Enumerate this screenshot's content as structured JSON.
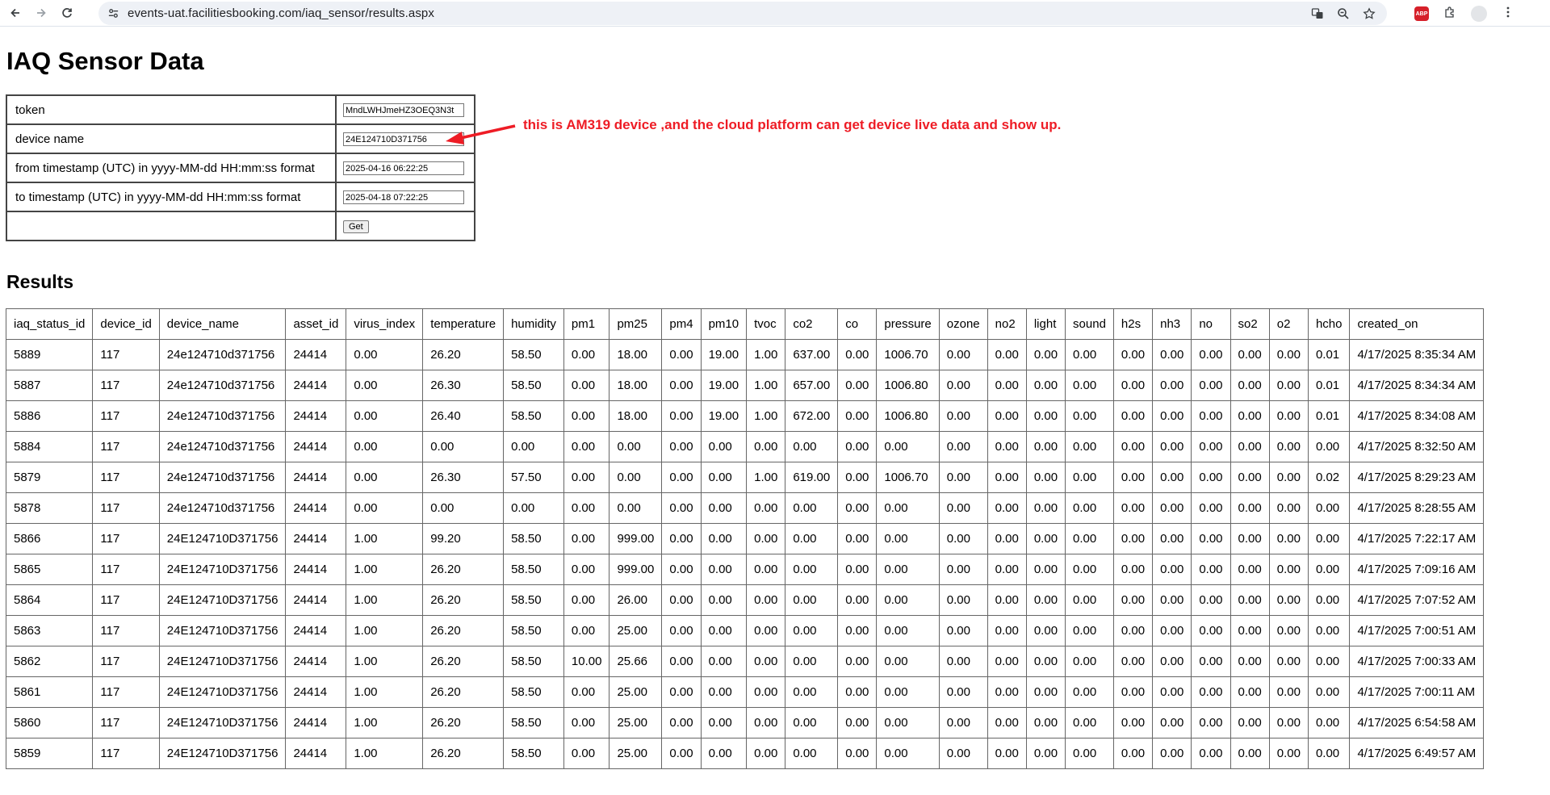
{
  "browser": {
    "url": "events-uat.facilitiesbooking.com/iaq_sensor/results.aspx"
  },
  "page": {
    "title": "IAQ Sensor Data",
    "results_heading": "Results"
  },
  "form": {
    "token_label": "token",
    "token_value": "MndLWHJmeHZ3OEQ3N3t",
    "device_label": "device name",
    "device_value": "24E124710D371756",
    "from_label": "from timestamp (UTC) in yyyy-MM-dd HH:mm:ss format",
    "from_value": "2025-04-16 06:22:25",
    "to_label": "to timestamp (UTC) in yyyy-MM-dd HH:mm:ss format",
    "to_value": "2025-04-18 07:22:25",
    "get_label": "Get"
  },
  "annotation": {
    "text": "this is AM319 device ,and the cloud platform can get device live data and show up.",
    "color": "#ee1c25"
  },
  "table": {
    "columns": [
      "iaq_status_id",
      "device_id",
      "device_name",
      "asset_id",
      "virus_index",
      "temperature",
      "humidity",
      "pm1",
      "pm25",
      "pm4",
      "pm10",
      "tvoc",
      "co2",
      "co",
      "pressure",
      "ozone",
      "no2",
      "light",
      "sound",
      "h2s",
      "nh3",
      "no",
      "so2",
      "o2",
      "hcho",
      "created_on"
    ],
    "rows": [
      [
        "5889",
        "117",
        "24e124710d371756",
        "24414",
        "0.00",
        "26.20",
        "58.50",
        "0.00",
        "18.00",
        "0.00",
        "19.00",
        "1.00",
        "637.00",
        "0.00",
        "1006.70",
        "0.00",
        "0.00",
        "0.00",
        "0.00",
        "0.00",
        "0.00",
        "0.00",
        "0.00",
        "0.00",
        "0.01",
        "4/17/2025 8:35:34 AM"
      ],
      [
        "5887",
        "117",
        "24e124710d371756",
        "24414",
        "0.00",
        "26.30",
        "58.50",
        "0.00",
        "18.00",
        "0.00",
        "19.00",
        "1.00",
        "657.00",
        "0.00",
        "1006.80",
        "0.00",
        "0.00",
        "0.00",
        "0.00",
        "0.00",
        "0.00",
        "0.00",
        "0.00",
        "0.00",
        "0.01",
        "4/17/2025 8:34:34 AM"
      ],
      [
        "5886",
        "117",
        "24e124710d371756",
        "24414",
        "0.00",
        "26.40",
        "58.50",
        "0.00",
        "18.00",
        "0.00",
        "19.00",
        "1.00",
        "672.00",
        "0.00",
        "1006.80",
        "0.00",
        "0.00",
        "0.00",
        "0.00",
        "0.00",
        "0.00",
        "0.00",
        "0.00",
        "0.00",
        "0.01",
        "4/17/2025 8:34:08 AM"
      ],
      [
        "5884",
        "117",
        "24e124710d371756",
        "24414",
        "0.00",
        "0.00",
        "0.00",
        "0.00",
        "0.00",
        "0.00",
        "0.00",
        "0.00",
        "0.00",
        "0.00",
        "0.00",
        "0.00",
        "0.00",
        "0.00",
        "0.00",
        "0.00",
        "0.00",
        "0.00",
        "0.00",
        "0.00",
        "0.00",
        "4/17/2025 8:32:50 AM"
      ],
      [
        "5879",
        "117",
        "24e124710d371756",
        "24414",
        "0.00",
        "26.30",
        "57.50",
        "0.00",
        "0.00",
        "0.00",
        "0.00",
        "1.00",
        "619.00",
        "0.00",
        "1006.70",
        "0.00",
        "0.00",
        "0.00",
        "0.00",
        "0.00",
        "0.00",
        "0.00",
        "0.00",
        "0.00",
        "0.02",
        "4/17/2025 8:29:23 AM"
      ],
      [
        "5878",
        "117",
        "24e124710d371756",
        "24414",
        "0.00",
        "0.00",
        "0.00",
        "0.00",
        "0.00",
        "0.00",
        "0.00",
        "0.00",
        "0.00",
        "0.00",
        "0.00",
        "0.00",
        "0.00",
        "0.00",
        "0.00",
        "0.00",
        "0.00",
        "0.00",
        "0.00",
        "0.00",
        "0.00",
        "4/17/2025 8:28:55 AM"
      ],
      [
        "5866",
        "117",
        "24E124710D371756",
        "24414",
        "1.00",
        "99.20",
        "58.50",
        "0.00",
        "999.00",
        "0.00",
        "0.00",
        "0.00",
        "0.00",
        "0.00",
        "0.00",
        "0.00",
        "0.00",
        "0.00",
        "0.00",
        "0.00",
        "0.00",
        "0.00",
        "0.00",
        "0.00",
        "0.00",
        "4/17/2025 7:22:17 AM"
      ],
      [
        "5865",
        "117",
        "24E124710D371756",
        "24414",
        "1.00",
        "26.20",
        "58.50",
        "0.00",
        "999.00",
        "0.00",
        "0.00",
        "0.00",
        "0.00",
        "0.00",
        "0.00",
        "0.00",
        "0.00",
        "0.00",
        "0.00",
        "0.00",
        "0.00",
        "0.00",
        "0.00",
        "0.00",
        "0.00",
        "4/17/2025 7:09:16 AM"
      ],
      [
        "5864",
        "117",
        "24E124710D371756",
        "24414",
        "1.00",
        "26.20",
        "58.50",
        "0.00",
        "26.00",
        "0.00",
        "0.00",
        "0.00",
        "0.00",
        "0.00",
        "0.00",
        "0.00",
        "0.00",
        "0.00",
        "0.00",
        "0.00",
        "0.00",
        "0.00",
        "0.00",
        "0.00",
        "0.00",
        "4/17/2025 7:07:52 AM"
      ],
      [
        "5863",
        "117",
        "24E124710D371756",
        "24414",
        "1.00",
        "26.20",
        "58.50",
        "0.00",
        "25.00",
        "0.00",
        "0.00",
        "0.00",
        "0.00",
        "0.00",
        "0.00",
        "0.00",
        "0.00",
        "0.00",
        "0.00",
        "0.00",
        "0.00",
        "0.00",
        "0.00",
        "0.00",
        "0.00",
        "4/17/2025 7:00:51 AM"
      ],
      [
        "5862",
        "117",
        "24E124710D371756",
        "24414",
        "1.00",
        "26.20",
        "58.50",
        "10.00",
        "25.66",
        "0.00",
        "0.00",
        "0.00",
        "0.00",
        "0.00",
        "0.00",
        "0.00",
        "0.00",
        "0.00",
        "0.00",
        "0.00",
        "0.00",
        "0.00",
        "0.00",
        "0.00",
        "0.00",
        "4/17/2025 7:00:33 AM"
      ],
      [
        "5861",
        "117",
        "24E124710D371756",
        "24414",
        "1.00",
        "26.20",
        "58.50",
        "0.00",
        "25.00",
        "0.00",
        "0.00",
        "0.00",
        "0.00",
        "0.00",
        "0.00",
        "0.00",
        "0.00",
        "0.00",
        "0.00",
        "0.00",
        "0.00",
        "0.00",
        "0.00",
        "0.00",
        "0.00",
        "4/17/2025 7:00:11 AM"
      ],
      [
        "5860",
        "117",
        "24E124710D371756",
        "24414",
        "1.00",
        "26.20",
        "58.50",
        "0.00",
        "25.00",
        "0.00",
        "0.00",
        "0.00",
        "0.00",
        "0.00",
        "0.00",
        "0.00",
        "0.00",
        "0.00",
        "0.00",
        "0.00",
        "0.00",
        "0.00",
        "0.00",
        "0.00",
        "0.00",
        "4/17/2025 6:54:58 AM"
      ],
      [
        "5859",
        "117",
        "24E124710D371756",
        "24414",
        "1.00",
        "26.20",
        "58.50",
        "0.00",
        "25.00",
        "0.00",
        "0.00",
        "0.00",
        "0.00",
        "0.00",
        "0.00",
        "0.00",
        "0.00",
        "0.00",
        "0.00",
        "0.00",
        "0.00",
        "0.00",
        "0.00",
        "0.00",
        "0.00",
        "4/17/2025 6:49:57 AM"
      ]
    ]
  }
}
